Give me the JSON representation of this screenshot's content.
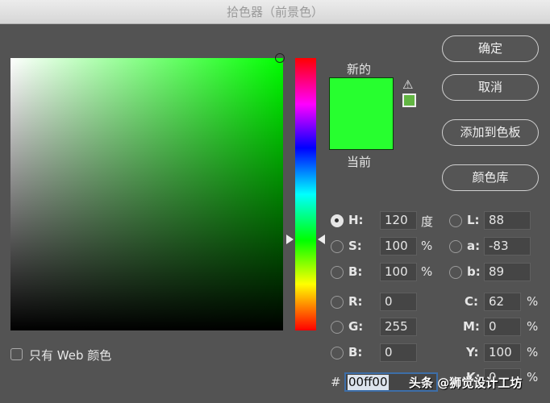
{
  "title": "拾色器（前景色）",
  "colors": {
    "hue_deg": 120,
    "new": "#27ff2f",
    "gamut_swatch": "#62b543"
  },
  "swatch": {
    "new_label": "新的",
    "current_label": "当前"
  },
  "icons": {
    "warning": "warning-triangle-icon",
    "gamut": "web-safe-cube-icon"
  },
  "buttons": {
    "ok": "确定",
    "cancel": "取消",
    "add_swatch": "添加到色板",
    "library": "颜色库"
  },
  "web_only": "只有 Web 颜色",
  "fields": {
    "H": {
      "label": "H:",
      "value": "120",
      "unit": "度",
      "selected": true
    },
    "S": {
      "label": "S:",
      "value": "100",
      "unit": "%"
    },
    "Bv": {
      "label": "B:",
      "value": "100",
      "unit": "%"
    },
    "R": {
      "label": "R:",
      "value": "0"
    },
    "G": {
      "label": "G:",
      "value": "255"
    },
    "Bl": {
      "label": "B:",
      "value": "0"
    },
    "L": {
      "label": "L:",
      "value": "88"
    },
    "a": {
      "label": "a:",
      "value": "-83"
    },
    "b": {
      "label": "b:",
      "value": "89"
    },
    "C": {
      "label": "C:",
      "value": "62",
      "unit": "%"
    },
    "M": {
      "label": "M:",
      "value": "0",
      "unit": "%"
    },
    "Y": {
      "label": "Y:",
      "value": "100",
      "unit": "%"
    },
    "K": {
      "label": "K:",
      "value": "0",
      "unit": "%"
    }
  },
  "hex": {
    "label": "#",
    "value": "00ff00"
  },
  "watermark": "头条 @狮觉设计工坊"
}
